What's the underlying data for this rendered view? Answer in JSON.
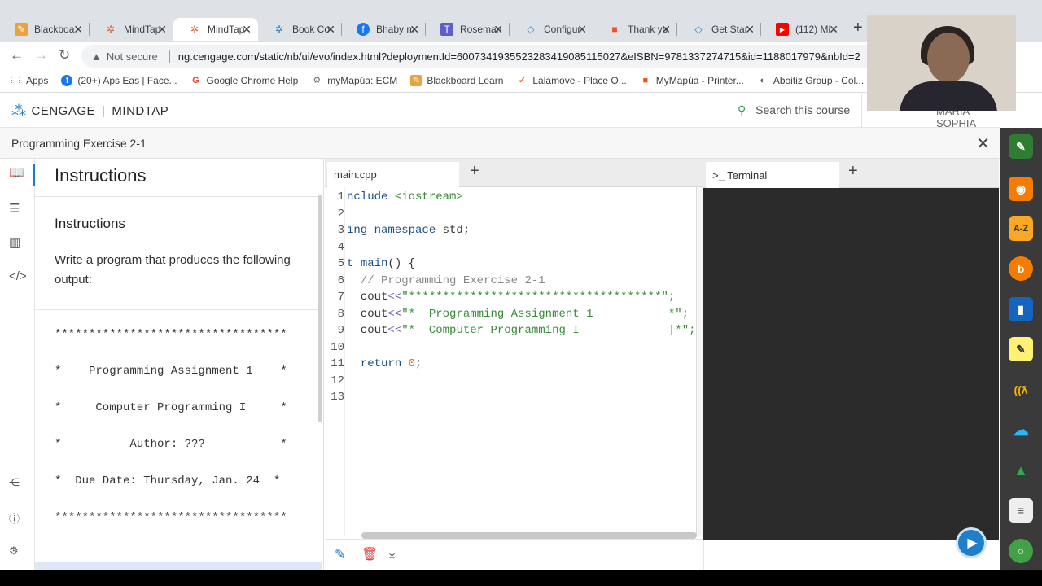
{
  "browser": {
    "tabs": [
      {
        "label": "Blackboard",
        "icon_color": "#e8a33d",
        "icon": "✎"
      },
      {
        "label": "MindTap",
        "icon_color": "#e05a2b",
        "icon": "✲"
      },
      {
        "label": "MindTap",
        "icon_color": "#e05a2b",
        "icon": "✲"
      },
      {
        "label": "Book Co",
        "icon_color": "#1a7dc4",
        "icon": "✲"
      },
      {
        "label": "Bhaby m",
        "icon_color": "#1877f2",
        "icon": "f"
      },
      {
        "label": "Roseman",
        "icon_color": "#5b5fc7",
        "icon": "T"
      },
      {
        "label": "Configur",
        "icon_color": "#1f8ad2",
        "icon": "◇"
      },
      {
        "label": "Thank yo",
        "icon_color": "#f25022",
        "icon": "■"
      },
      {
        "label": "Get Star",
        "icon_color": "#1f8ad2",
        "icon": "◇"
      },
      {
        "label": "(112) Mi",
        "icon_color": "#ff0000",
        "icon": "▶"
      }
    ],
    "close_glyph": "✕",
    "new_tab_glyph": "+",
    "security_label": "Not secure",
    "url": "ng.cengage.com/static/nb/ui/evo/index.html?deploymentId=6007341935523283419085115027&eISBN=9781337274715&id=1188017979&nbId=2",
    "bookmarks": [
      {
        "label": "Apps",
        "icon_color": "#4285f4",
        "icon": "⋮⋮"
      },
      {
        "label": "(20+) Aps Eas | Face...",
        "icon_color": "#1877f2",
        "icon": "f"
      },
      {
        "label": "Google Chrome Help",
        "icon_color": "#ea4335",
        "icon": "G"
      },
      {
        "label": "myMapúa: ECM",
        "icon_color": "#6d6d6d",
        "icon": "⚙"
      },
      {
        "label": "Blackboard Learn",
        "icon_color": "#e8a33d",
        "icon": "✎"
      },
      {
        "label": "Lalamove - Place O...",
        "icon_color": "#f16622",
        "icon": "✓"
      },
      {
        "label": "MyMapúa - Printer...",
        "icon_color": "#f25022",
        "icon": "■"
      },
      {
        "label": "Aboitiz Group - Col...",
        "icon_color": "#555555",
        "icon": "◐"
      }
    ]
  },
  "cengage": {
    "brand_left": "CENGAGE",
    "brand_right": "MINDTAP",
    "search_label": "Search this course",
    "user_name": "MARIA SOPHIA"
  },
  "activity": {
    "title": "Programming Exercise 2-1",
    "close_glyph": "✕"
  },
  "instructions": {
    "panel_title": "Instructions",
    "section_title": "Instructions",
    "description": "Write a program that produces the following output:",
    "output_lines": [
      "**********************************",
      "*    Programming Assignment 1    *",
      "*     Computer Programming I     *",
      "*          Author: ???           *",
      "*  Due Date: Thursday, Jan. 24  *",
      "**********************************"
    ]
  },
  "editor": {
    "file_tab": "main.cpp",
    "add_glyph": "+",
    "line_numbers": [
      "1",
      "2",
      "3",
      "4",
      "5",
      "6",
      "7",
      "8",
      "9",
      "10",
      "11",
      "12",
      "13"
    ]
  },
  "terminal": {
    "tab_label": ">_ Terminal",
    "add_glyph": "+"
  },
  "colors": {
    "accent": "#1a7dc4",
    "terminal_bg": "#2b2b2b",
    "dock_bg": "#3a3a3a"
  }
}
